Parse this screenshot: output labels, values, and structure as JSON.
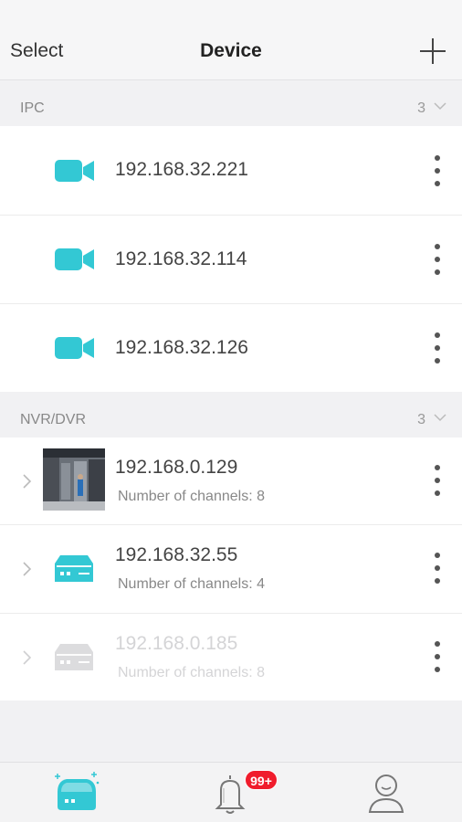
{
  "header": {
    "select_label": "Select",
    "title": "Device",
    "add_icon": "plus-icon"
  },
  "sections": [
    {
      "label": "IPC",
      "count": "3",
      "devices": [
        {
          "ip": "192.168.32.221",
          "icon": "camera-icon"
        },
        {
          "ip": "192.168.32.114",
          "icon": "camera-icon"
        },
        {
          "ip": "192.168.32.126",
          "icon": "camera-icon"
        }
      ]
    },
    {
      "label": "NVR/DVR",
      "count": "3",
      "devices": [
        {
          "ip": "192.168.0.129",
          "channels": "Number of channels: 8",
          "icon": "thumbnail",
          "enabled": true
        },
        {
          "ip": "192.168.32.55",
          "channels": "Number of channels: 4",
          "icon": "nvr-icon",
          "enabled": true
        },
        {
          "ip": "192.168.0.185",
          "channels": "Number of channels: 8",
          "icon": "nvr-icon",
          "enabled": false
        }
      ]
    }
  ],
  "tabbar": {
    "tabs": [
      "device-tab",
      "alarm-tab",
      "profile-tab"
    ],
    "badge": "99+"
  },
  "colors": {
    "accent": "#33c8d4",
    "badge": "#f01c2c",
    "disabled": "#d4d4d6"
  }
}
